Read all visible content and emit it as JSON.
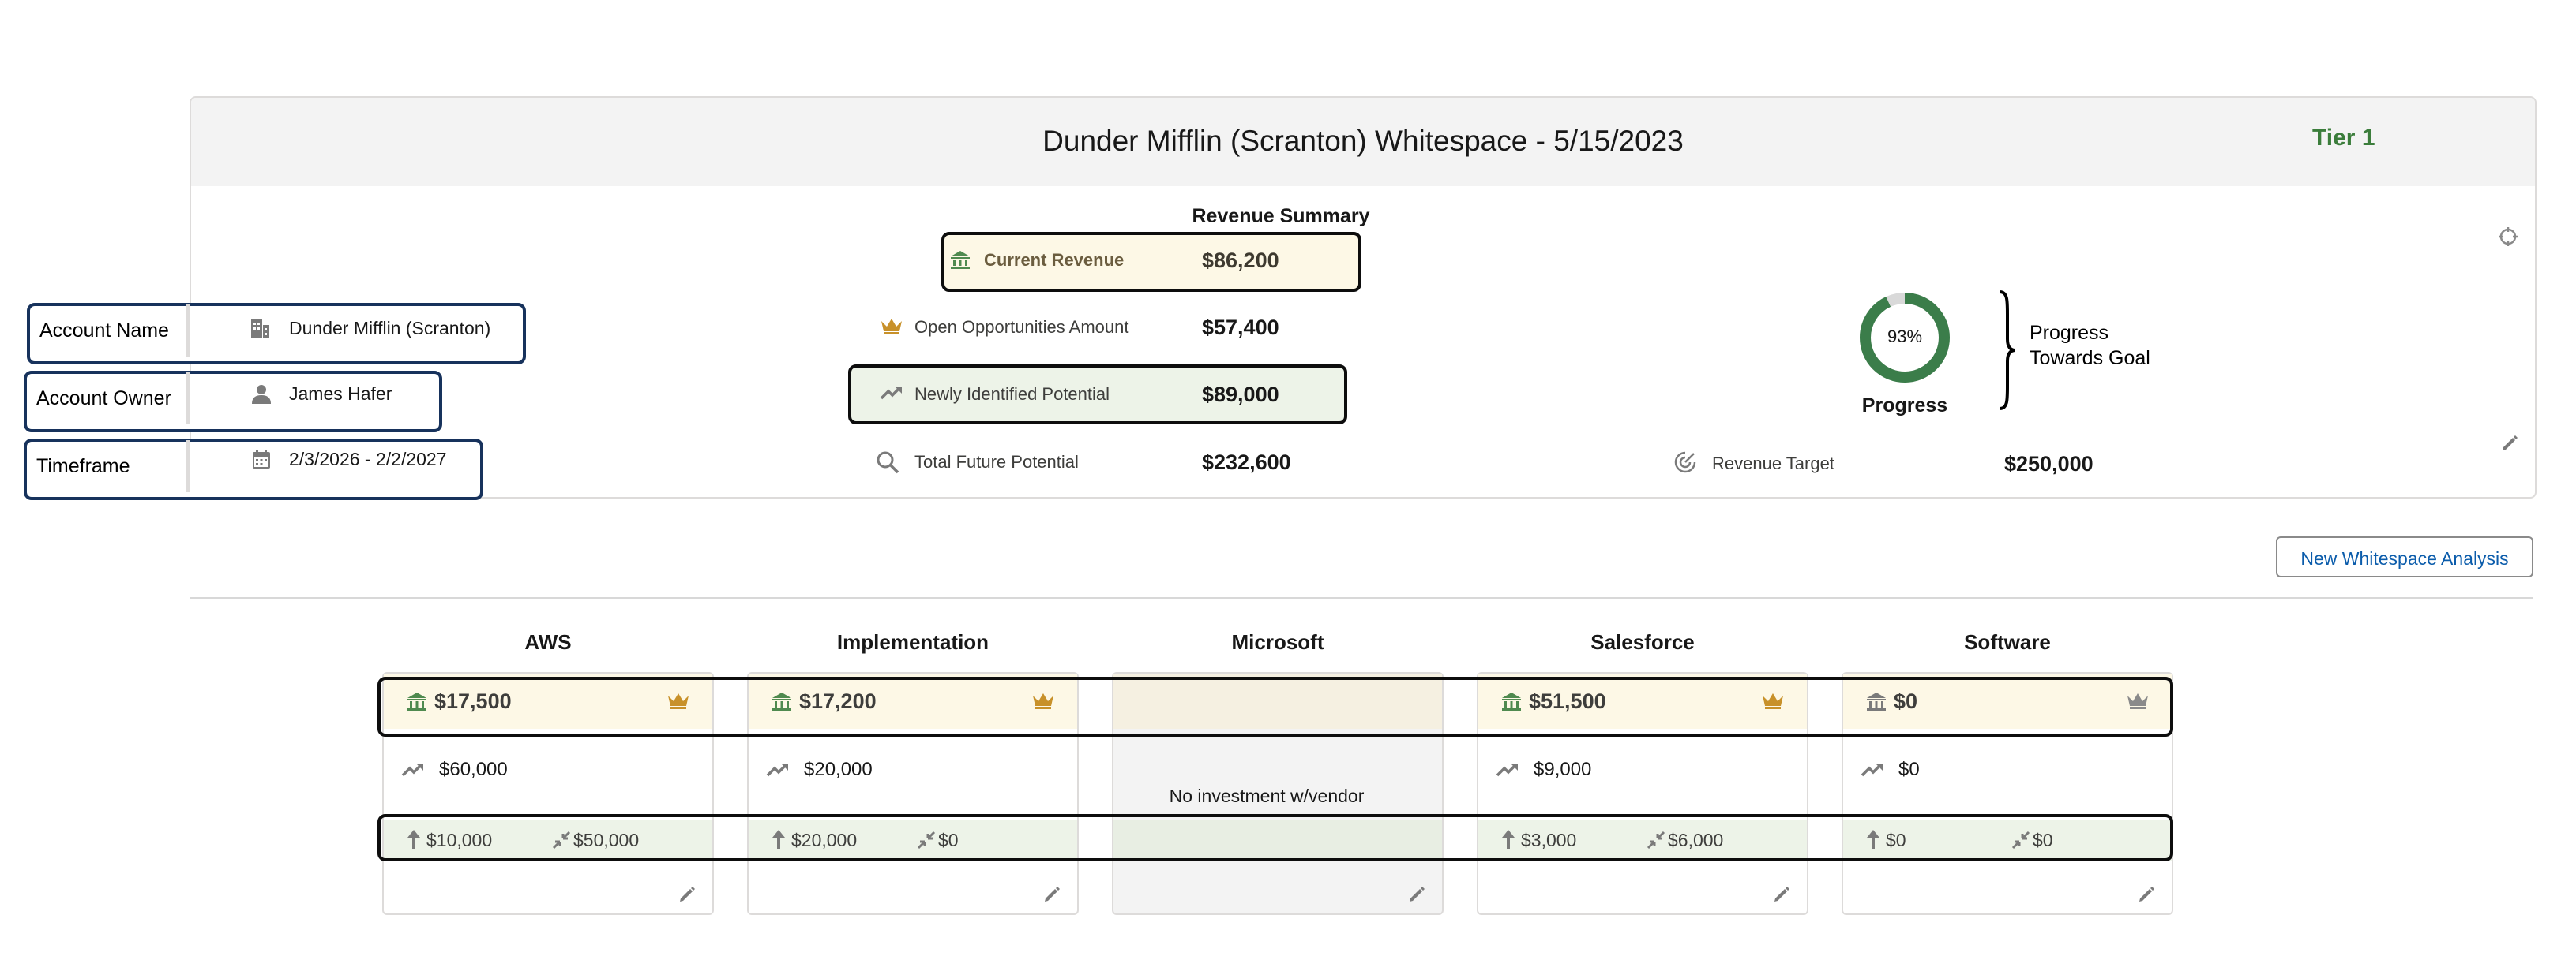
{
  "header": {
    "title": "Dunder Mifflin (Scranton) Whitespace - 5/15/2023",
    "tier": "Tier 1"
  },
  "account": {
    "name": "Dunder Mifflin (Scranton)",
    "owner": "James Hafer",
    "timeframe": "2/3/2026 - 2/2/2027"
  },
  "callouts": {
    "account_name": "Account Name",
    "account_owner": "Account Owner",
    "timeframe": "Timeframe",
    "progress_note_line1": "Progress",
    "progress_note_line2": "Towards Goal"
  },
  "revenue_summary": {
    "title": "Revenue Summary",
    "current_revenue": {
      "label": "Current Revenue",
      "value": "$86,200"
    },
    "open_opportunities": {
      "label": "Open Opportunities Amount",
      "value": "$57,400"
    },
    "newly_identified": {
      "label": "Newly Identified Potential",
      "value": "$89,000"
    },
    "total_future": {
      "label": "Total Future Potential",
      "value": "$232,600"
    }
  },
  "revenue_target": {
    "label": "Revenue Target",
    "value": "$250,000"
  },
  "progress": {
    "percent_text": "93%",
    "percent": 93,
    "label": "Progress"
  },
  "actions": {
    "new_whitespace": "New Whitespace Analysis"
  },
  "vendors": [
    {
      "name": "AWS",
      "current": "$17,500",
      "opportunity": "$60,000",
      "upsell": "$10,000",
      "cross": "$50,000"
    },
    {
      "name": "Implementation",
      "current": "$17,200",
      "opportunity": "$20,000",
      "upsell": "$20,000",
      "cross": "$0"
    },
    {
      "name": "Microsoft",
      "no_investment": "No investment w/vendor"
    },
    {
      "name": "Salesforce",
      "current": "$51,500",
      "opportunity": "$9,000",
      "upsell": "$3,000",
      "cross": "$6,000"
    },
    {
      "name": "Software",
      "current": "$0",
      "opportunity": "$0",
      "upsell": "$0",
      "cross": "$0"
    }
  ],
  "colors": {
    "tier_green": "#3b7d3b",
    "progress_green": "#3b7d4a",
    "progress_track": "#d9d9d9",
    "current_revenue_bg": "#fdf8e6",
    "potential_bg": "#edf3e8",
    "callout_border": "#17325c",
    "crown_gold": "#c8912a"
  }
}
